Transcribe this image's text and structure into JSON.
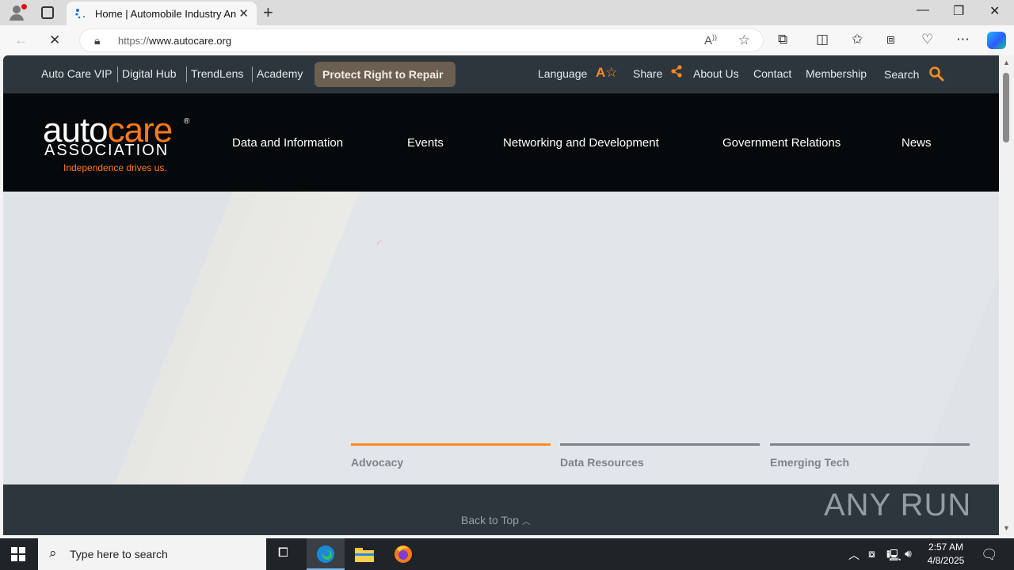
{
  "browser": {
    "tab_title": "Home | Automobile Industry An",
    "url_host_prefix": "https://",
    "url_domain": "www.autocare.org"
  },
  "site": {
    "utility_links": [
      "Auto Care VIP",
      "Digital Hub",
      "TrendLens",
      "Academy"
    ],
    "cta_button": "Protect Right to Repair",
    "right_links": {
      "language": "Language",
      "share": "Share",
      "about": "About Us",
      "contact": "Contact",
      "membership": "Membership",
      "search": "Search"
    },
    "logo": {
      "word_auto": "auto",
      "word_care": "care",
      "word_association": "ASSOCIATION",
      "tagline": "Independence drives us.",
      "registered": "®"
    },
    "main_nav": [
      "Data and Information",
      "Events",
      "Networking and Development",
      "Government Relations",
      "News"
    ],
    "features": [
      {
        "label": "Advocacy",
        "active": true
      },
      {
        "label": "Data Resources",
        "active": false
      },
      {
        "label": "Emerging Tech",
        "active": false
      }
    ],
    "back_to_top": "Back to Top",
    "watermark": "ANY RUN",
    "accent_color": "#ff8a1f"
  },
  "taskbar": {
    "search_placeholder": "Type here to search",
    "time": "2:57 AM",
    "date": "4/8/2025"
  }
}
